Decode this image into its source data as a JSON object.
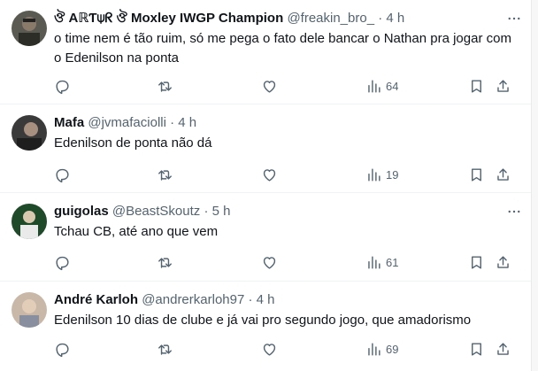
{
  "tweets": [
    {
      "name": "ঔ AℝƬ⍦ᖇ ঔ Moxley IWGP Champion",
      "handle": "@freakin_bro_",
      "time": "4 h",
      "text": "o time nem é tão ruim, só me pega o fato dele bancar o Nathan pra jogar com o Edenilson na ponta",
      "views": "64",
      "avatar_color": "#5a5a52"
    },
    {
      "name": "Mafa",
      "handle": "@jvmafaciolli",
      "time": "4 h",
      "text": "Edenilson de ponta não dá",
      "views": "19",
      "avatar_color": "#3a3a3a"
    },
    {
      "name": "guigolas",
      "handle": "@BeastSkoutz",
      "time": "5 h",
      "text": "Tchau CB, até ano que vem",
      "views": "61",
      "avatar_color": "#1f4a2a"
    },
    {
      "name": "André Karloh",
      "handle": "@andrerkarloh97",
      "time": "4 h",
      "text": "Edenilson 10 dias de clube e já vai pro segundo jogo, que amadorismo",
      "views": "69",
      "avatar_color": "#c9b8a8"
    }
  ],
  "separator": "·",
  "icons": {
    "reply": "reply-icon",
    "retweet": "retweet-icon",
    "like": "like-icon",
    "views": "views-icon",
    "bookmark": "bookmark-icon",
    "share": "share-icon",
    "more": "more-icon"
  },
  "colors": {
    "text": "#0f1419",
    "secondary": "#536471",
    "border": "#eff3f4"
  }
}
